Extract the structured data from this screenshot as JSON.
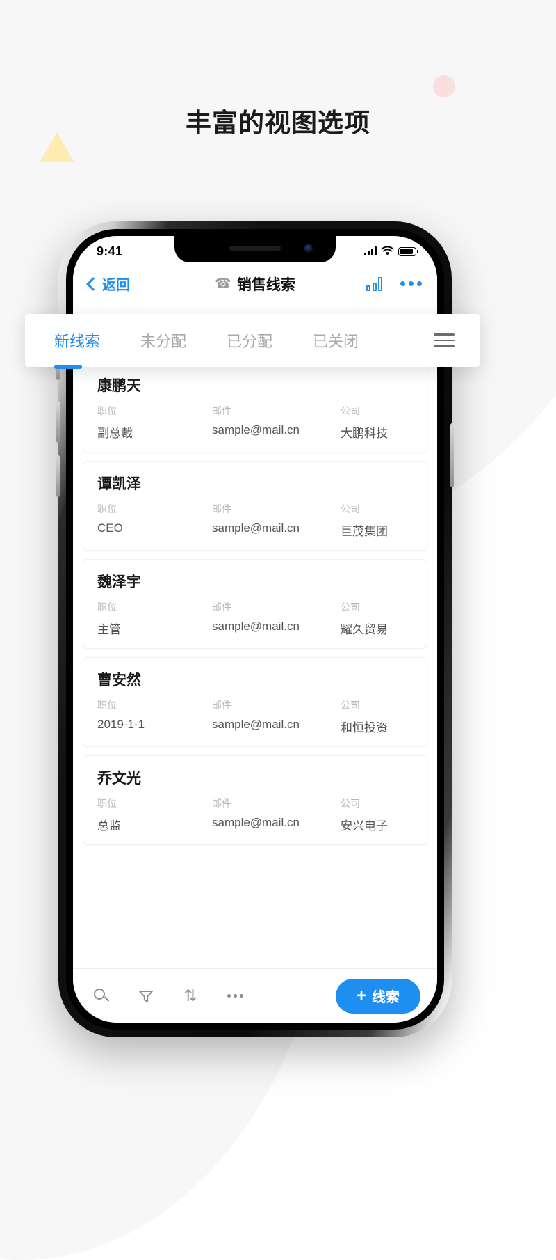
{
  "page": {
    "headline": "丰富的视图选项"
  },
  "status_bar": {
    "time": "9:41",
    "signal_icon": "cellular-signal-icon",
    "wifi_icon": "wifi-icon",
    "battery_icon": "battery-icon"
  },
  "nav_bar": {
    "back_label": "返回",
    "back_icon": "chevron-left-icon",
    "title": "销售线索",
    "title_icon": "phone-icon",
    "chart_icon": "bar-chart-icon",
    "more_icon": "more-horizontal-icon"
  },
  "tabs": {
    "items": [
      {
        "label": "新线索",
        "active": true
      },
      {
        "label": "未分配",
        "active": false
      },
      {
        "label": "已分配",
        "active": false
      },
      {
        "label": "已关闭",
        "active": false
      }
    ],
    "menu_icon": "hamburger-menu-icon"
  },
  "list": {
    "columns": {
      "position": "职位",
      "email": "邮件",
      "company": "公司"
    },
    "rows": [
      {
        "name": "康鹏天",
        "position": "副总裁",
        "email": "sample@mail.cn",
        "company": "大鹏科技"
      },
      {
        "name": "谭凯泽",
        "position": "CEO",
        "email": "sample@mail.cn",
        "company": "巨茂集团"
      },
      {
        "name": "魏泽宇",
        "position": "主管",
        "email": "sample@mail.cn",
        "company": "耀久贸易"
      },
      {
        "name": "曹安然",
        "position": "2019-1-1",
        "email": "sample@mail.cn",
        "company": "和恒投资"
      },
      {
        "name": "乔文光",
        "position": "总监",
        "email": "sample@mail.cn",
        "company": "安兴电子"
      }
    ]
  },
  "toolbar": {
    "search_icon": "search-icon",
    "filter_icon": "filter-funnel-icon",
    "sort_icon": "sort-arrows-icon",
    "sort_glyph": "⇅",
    "more_icon": "more-horizontal-icon",
    "add_plus": "+",
    "add_label": "线索"
  },
  "colors": {
    "accent": "#1f8ef1",
    "title_text": "#1a1a1a",
    "muted_text": "#b7b7b7",
    "value_text": "#555555",
    "deco_pink": "#fbdede",
    "deco_yellow": "#fdebb0"
  }
}
